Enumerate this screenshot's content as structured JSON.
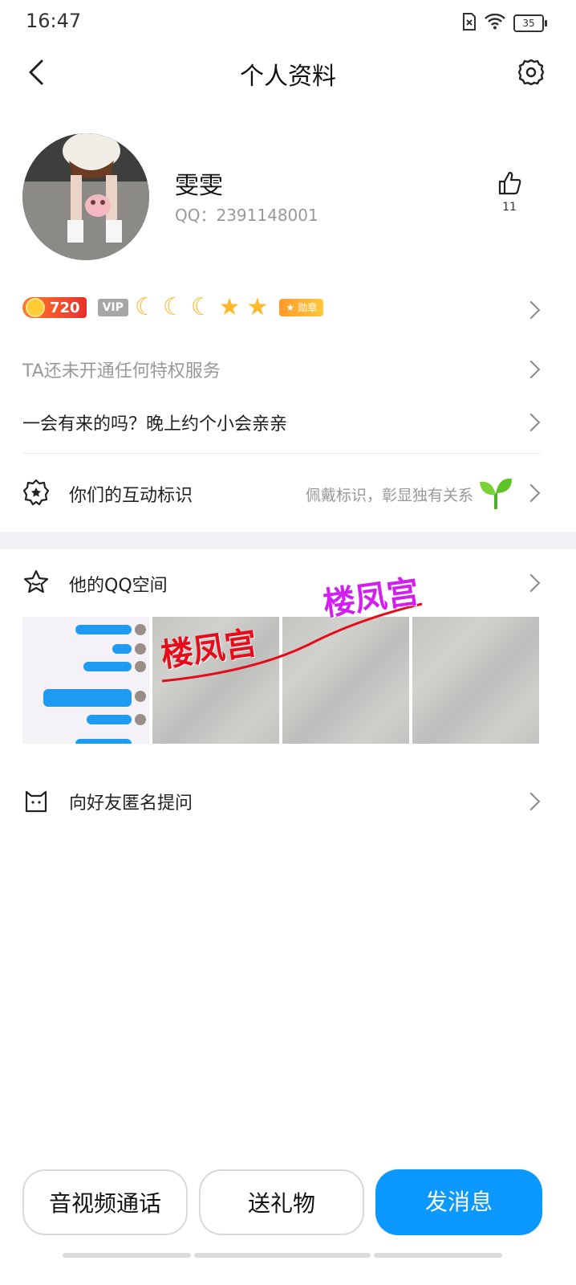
{
  "status_bar": {
    "time": "16:47",
    "battery": "35"
  },
  "nav": {
    "title": "个人资料"
  },
  "profile": {
    "nickname": "雯雯",
    "qq_label": "QQ：",
    "qq_number": "2391148001",
    "likes": "11"
  },
  "badges": {
    "level": "720",
    "vip": "VIP",
    "medal": "勋章"
  },
  "rows": {
    "privilege": "TA还未开通任何特权服务",
    "signature": "一会有来的吗？晚上约个小会亲亲",
    "interaction_label": "你们的互动标识",
    "interaction_hint": "佩戴标识，彰显独有关系",
    "qzone_label": "他的QQ空间",
    "ask_label": "向好友匿名提问"
  },
  "watermark": {
    "text1": "楼凤宫",
    "text2": "楼凤宫"
  },
  "actions": {
    "call": "音视频通话",
    "gift": "送礼物",
    "message": "发消息"
  },
  "colors": {
    "accent": "#0b99ff",
    "watermark_red": "#e60c1b",
    "watermark_purple": "#d21ff0"
  }
}
